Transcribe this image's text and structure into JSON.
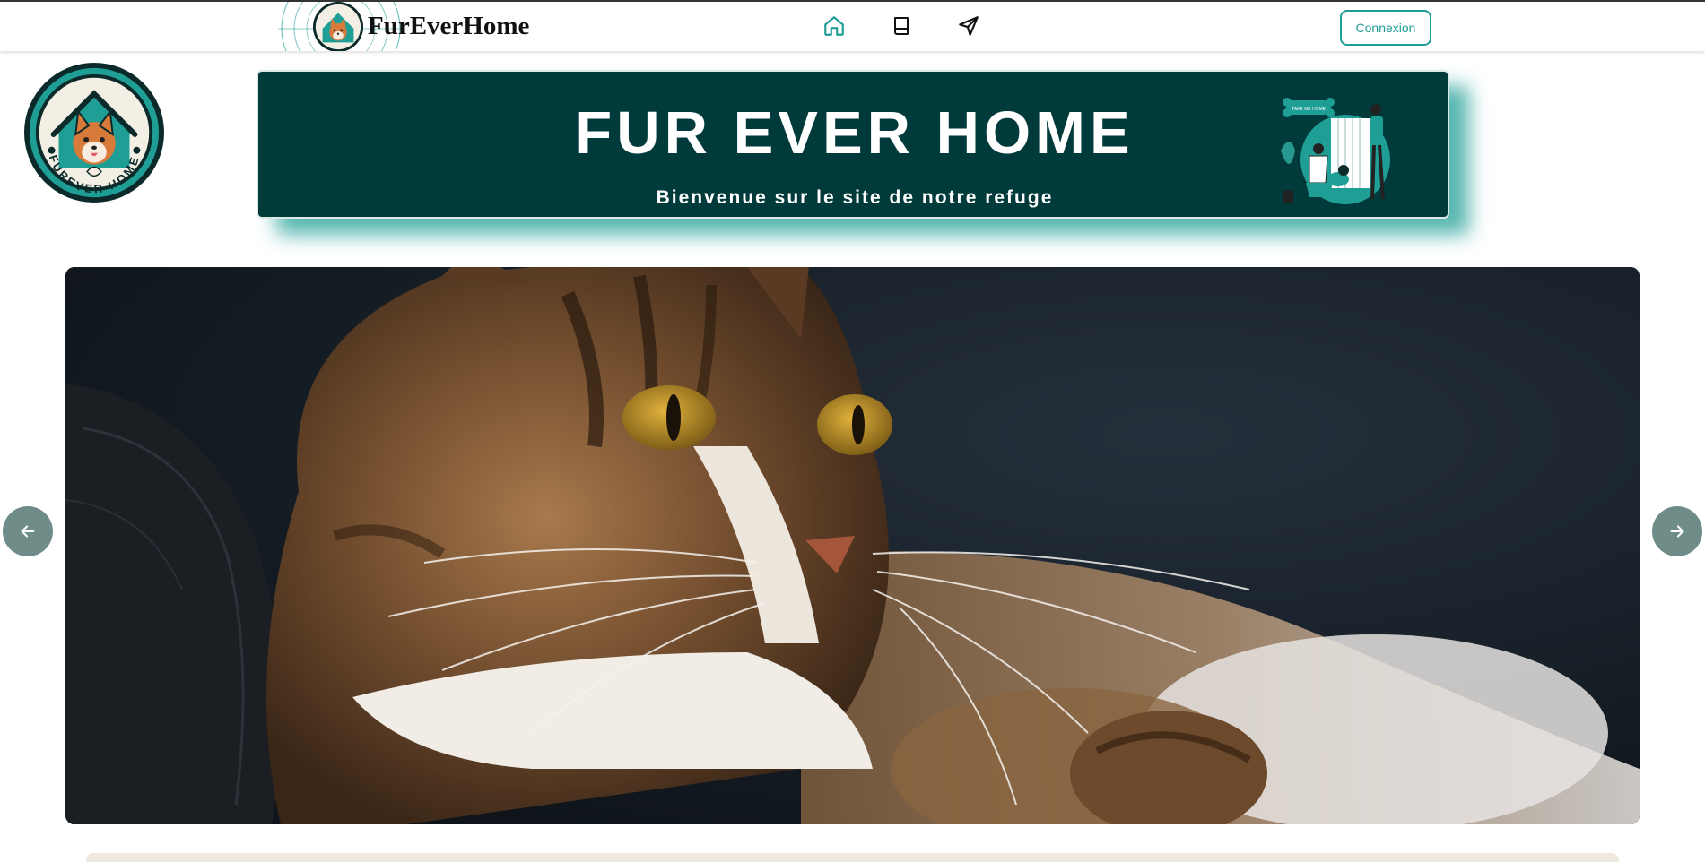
{
  "nav": {
    "brand_name": "FurEverHome",
    "items": [
      {
        "icon": "home-icon",
        "active": true
      },
      {
        "icon": "book-icon",
        "active": false
      },
      {
        "icon": "send-icon",
        "active": false
      }
    ],
    "login_label": "Connexion"
  },
  "header": {
    "logo_text": "FUREVER HOME",
    "title": "FUR EVER HOME",
    "subtitle": "Bienvenue sur le site de notre refuge",
    "illustration_sign": "TAKE ME HOME"
  },
  "colors": {
    "accent": "#1f9e96",
    "banner_bg": "#003a3a",
    "arrow_bg": "#6f8c88"
  }
}
